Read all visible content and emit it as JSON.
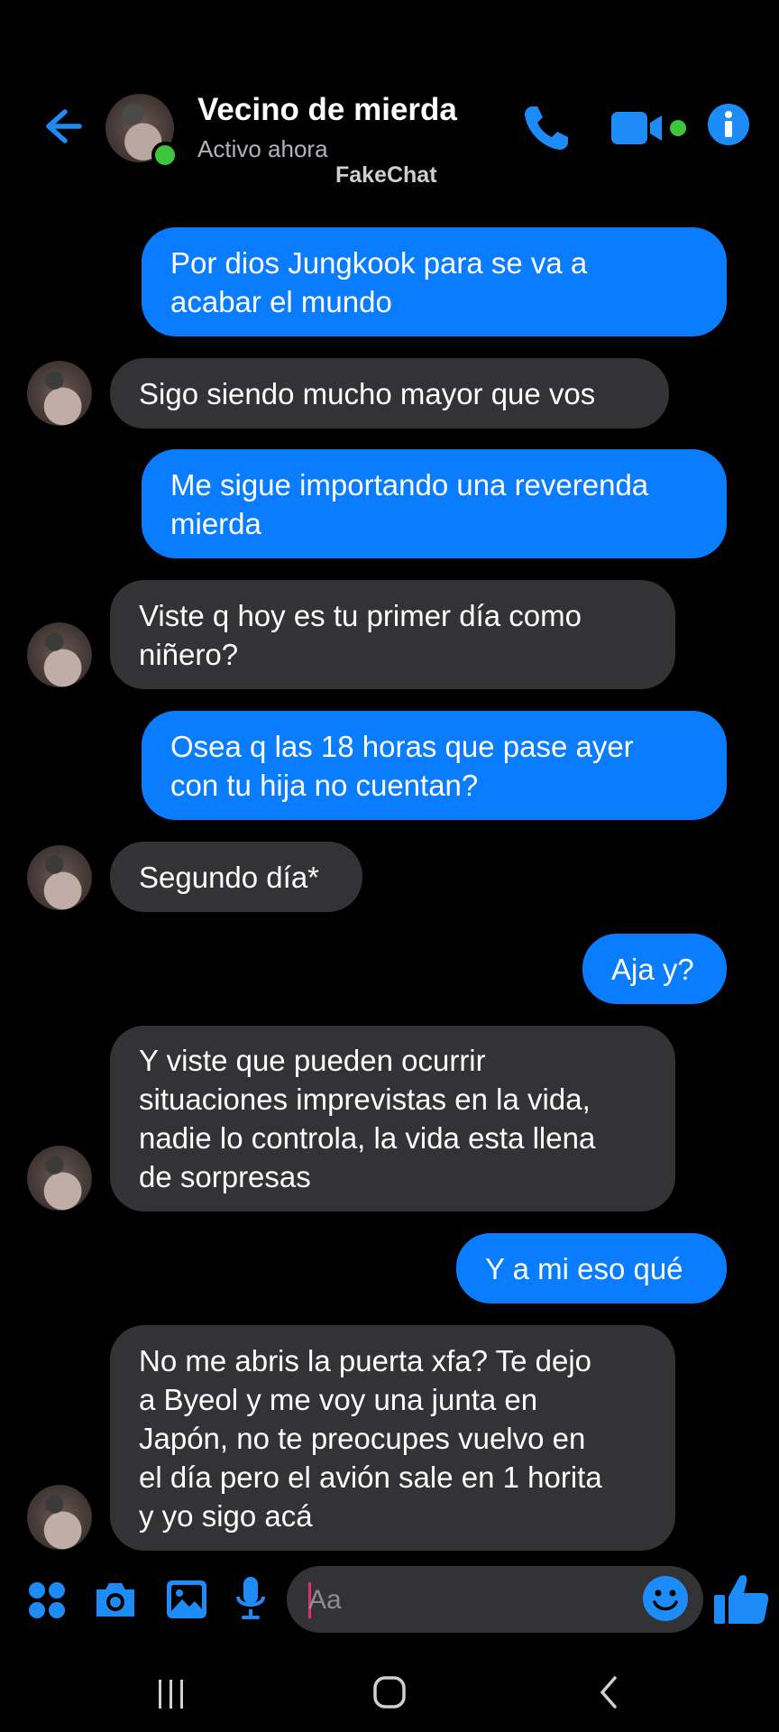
{
  "header": {
    "contact_name": "Vecino de mierda",
    "status": "Activo ahora",
    "watermark": "FakeChat"
  },
  "messages": [
    {
      "side": "out",
      "text": "Por dios Jungkook para se va a\nacabar el mundo"
    },
    {
      "side": "in",
      "text": "Sigo siendo mucho mayor que vos"
    },
    {
      "side": "out",
      "text": "Me sigue importando una reverenda\nmierda"
    },
    {
      "side": "in",
      "text": "Viste q hoy es tu primer día como\nniñero?"
    },
    {
      "side": "out",
      "text": "Osea q las 18 horas que pase ayer\ncon tu hija no cuentan?"
    },
    {
      "side": "in",
      "text": "Segundo día*"
    },
    {
      "side": "out",
      "text": "Aja y?"
    },
    {
      "side": "in",
      "text": "Y viste que pueden ocurrir\nsituaciones imprevistas en la vida,\nnadie lo controla, la vida esta llena\nde sorpresas"
    },
    {
      "side": "out",
      "text": "Y a mi eso qué"
    },
    {
      "side": "in",
      "text": "No me abris la puerta xfa? Te dejo\na Byeol y me voy una junta en\nJapón, no te preocupes vuelvo en\nel día pero el avión sale en 1 horita\ny yo sigo acá"
    }
  ],
  "composer": {
    "placeholder": "Aa"
  },
  "colors": {
    "accent": "#0a7cff",
    "incoming_bubble": "#333336",
    "online": "#3ec53e"
  },
  "icons": [
    "back-arrow-icon",
    "phone-icon",
    "video-camera-icon",
    "info-icon",
    "apps-icon",
    "camera-icon",
    "gallery-icon",
    "microphone-icon",
    "emoji-icon",
    "thumbs-up-icon",
    "recents-icon",
    "home-icon",
    "nav-back-icon"
  ]
}
